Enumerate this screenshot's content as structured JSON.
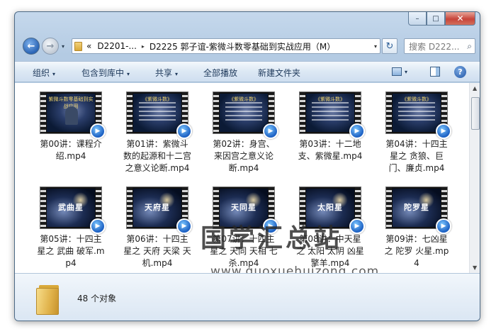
{
  "window": {
    "caption": {
      "minimize": "–",
      "maximize": "□",
      "close": "✕"
    }
  },
  "nav": {
    "back_icon": "←",
    "forward_icon": "→",
    "address": {
      "lead": "«",
      "crumb1": "D2201-...",
      "separator": "▸",
      "crumb2": "D2225 郭子谊-紫微斗数零基础到实战应用（M）",
      "dropdown": "▾"
    },
    "refresh_icon": "↻",
    "search_placeholder": "搜索 D222...",
    "search_icon": "⌕"
  },
  "toolbar": {
    "organize": "组织",
    "include_library": "包含到库中",
    "share": "共享",
    "play_all": "全部播放",
    "new_folder": "新建文件夹",
    "arrow": "▾",
    "help": "?"
  },
  "files": [
    {
      "name": "第00讲：课程介绍.mp4",
      "thumb_title": "紫微斗数零基础到实战应用",
      "thumb_big": ""
    },
    {
      "name": "第01讲：紫微斗数的起源和十二宫之意义论断.mp4",
      "thumb_title": "《紫微斗数》",
      "thumb_big": ""
    },
    {
      "name": "第02讲：身宫、来因宫之意义论断.mp4",
      "thumb_title": "《紫微斗数》",
      "thumb_big": ""
    },
    {
      "name": "第03讲：十二地支、紫微星.mp4",
      "thumb_title": "《紫微斗数》",
      "thumb_big": ""
    },
    {
      "name": "第04讲：十四主星之 贪狼、巨门、廉贞.mp4",
      "thumb_title": "《紫微斗数》",
      "thumb_big": ""
    },
    {
      "name": "第05讲：十四主星之 武曲 破军.mp4",
      "thumb_title": "",
      "thumb_big": "武曲星"
    },
    {
      "name": "第06讲：十四主星之 天府 天梁 天机.mp4",
      "thumb_title": "",
      "thumb_big": "天府星"
    },
    {
      "name": "第07讲：十四主星之 天同 天相 七杀.mp4",
      "thumb_title": "",
      "thumb_big": "天同星"
    },
    {
      "name": "第08讲：中天星之 太阳 太阴 凶星擎羊.mp4",
      "thumb_title": "",
      "thumb_big": "太阳星"
    },
    {
      "name": "第09讲：七凶星之 陀罗 火星.mp4",
      "thumb_title": "",
      "thumb_big": "陀罗星"
    }
  ],
  "watermark": {
    "text": "国学汇总站",
    "url": "www.guoxuehuizong.com"
  },
  "status": {
    "count": "48 个对象"
  },
  "scroll": {
    "up": "▲",
    "down": "▼"
  },
  "play_badge": "▶"
}
